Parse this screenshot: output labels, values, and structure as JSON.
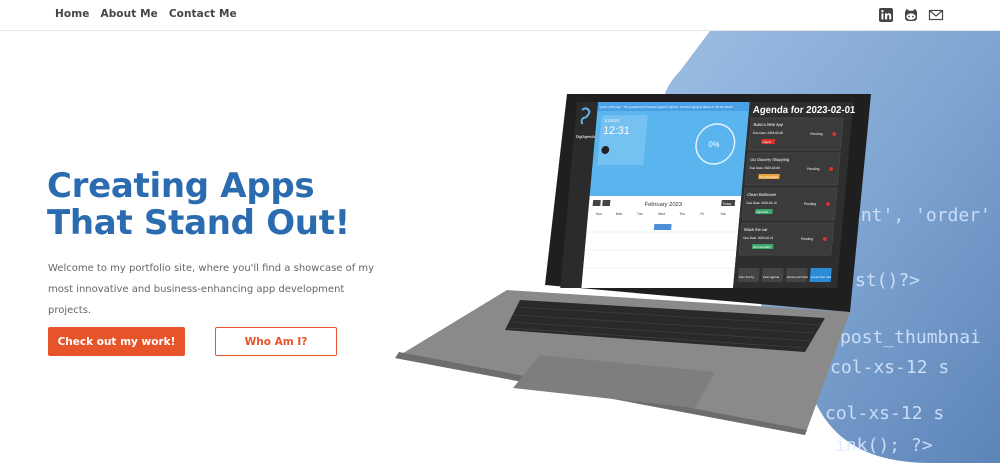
{
  "nav": {
    "links": [
      "Home",
      "About Me",
      "Contact Me"
    ],
    "icons": [
      "linkedin-icon",
      "github-icon",
      "mail-icon"
    ]
  },
  "hero": {
    "title_line1": "Creating Apps",
    "title_line2": "That Stand Out!",
    "description_line1": "Welcome to my portfolio site, where you'll find a showcase of my",
    "description_line2": "most innovative and business-enhancing app development projects.",
    "primary_button": "Check out my work!",
    "secondary_button": "Who Am I?"
  },
  "background_code": [
    "unt', 'order'",
    "st()?>",
    "post_thumbnai",
    "col-xs-12 s",
    "col-xs-12 s",
    "ink(); ?>"
  ],
  "laptop_screen": {
    "app_name": "DigiAgenda",
    "banner": "Quote of the day: \"The greatest performance begins in silence. It's we're going to dance to \"Be the Music\"",
    "clock_date": "1/1/2023",
    "clock_time": "12:31",
    "progress": "0%",
    "calendar_month": "February 2023",
    "calendar_today_button": "Today",
    "weekdays": [
      "Sun",
      "Mon",
      "Tue",
      "Wed",
      "Thu",
      "Fri",
      "Sat"
    ],
    "agenda_title": "Agenda for 2023-02-01",
    "tasks": [
      {
        "title": "Build a Web App",
        "due": "Due Date: 2023-02-06",
        "priority": "Urgent",
        "status": "Pending",
        "priority_color": "#d9322b"
      },
      {
        "title": "Go Grocery Shopping",
        "due": "Due Date: 2023-02-09",
        "priority": "Very Important",
        "status": "Pending",
        "priority_color": "#e9a23b"
      },
      {
        "title": "Clean Bathroom",
        "due": "Due Date: 2023-02-10",
        "priority": "Important",
        "status": "Pending",
        "priority_color": "#3aa86b"
      },
      {
        "title": "Wash the car",
        "due": "Due Date: 2023-02-11",
        "priority": "Not Important",
        "status": "Pending",
        "priority_color": "#3aa86b"
      }
    ],
    "footer_buttons": [
      "Filter Sort by",
      "Clear Agenda",
      "Remove All Tasks",
      "Create New Task"
    ]
  },
  "colors": {
    "title_blue": "#2b6cb0",
    "accent_orange": "#e8542a",
    "code_panel": "#8fb2dc"
  }
}
